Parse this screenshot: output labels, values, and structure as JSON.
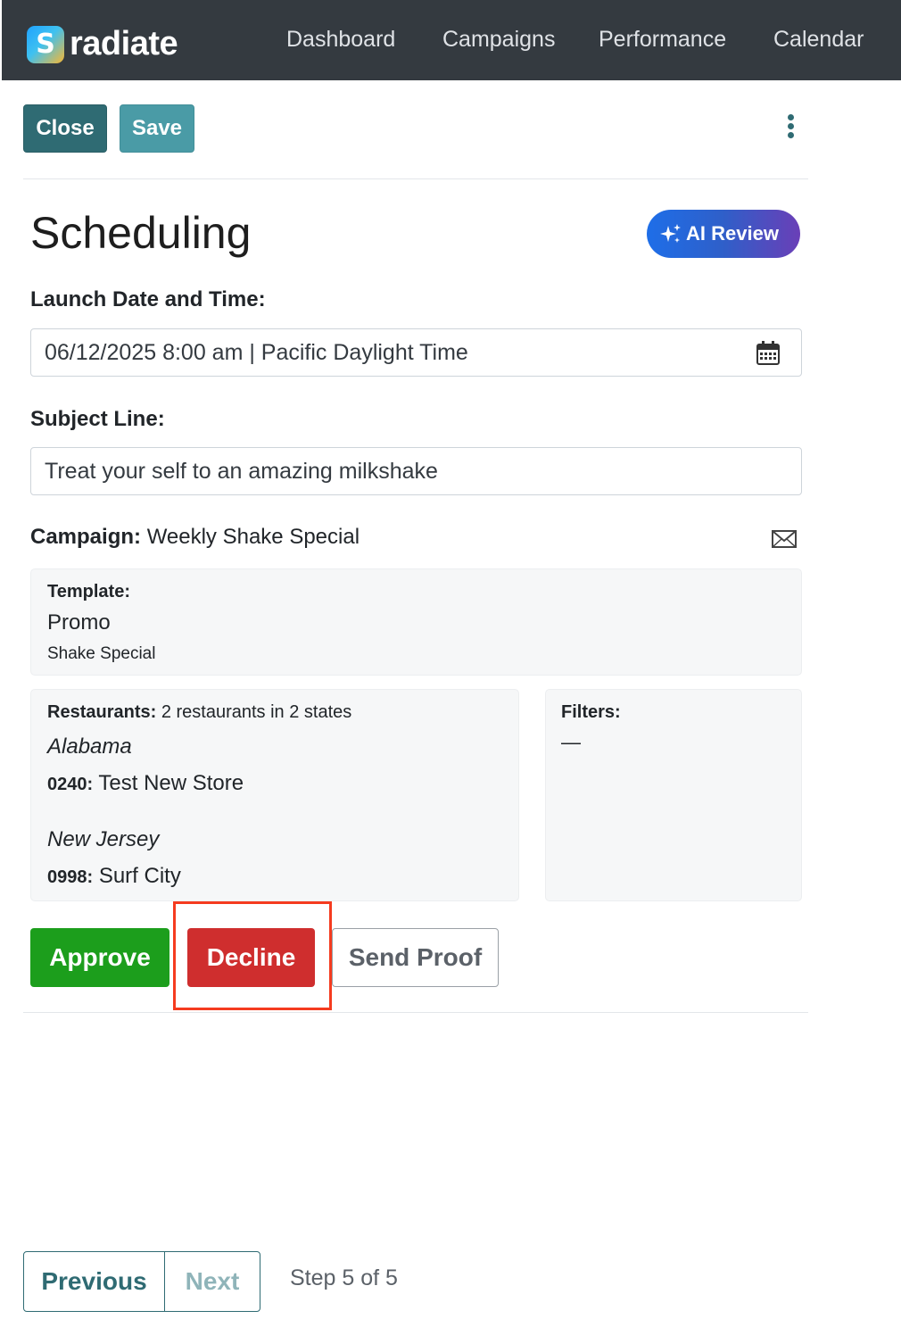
{
  "app": {
    "brand": "radiate",
    "brand_logo_letter": "S"
  },
  "nav": {
    "items": [
      {
        "label": "Dashboard"
      },
      {
        "label": "Campaigns"
      },
      {
        "label": "Performance"
      },
      {
        "label": "Calendar"
      }
    ]
  },
  "toolbar": {
    "close_label": "Close",
    "save_label": "Save",
    "more_icon": "kebab-menu-icon"
  },
  "page": {
    "title": "Scheduling",
    "ai_review_label": "AI Review"
  },
  "form": {
    "launch_label": "Launch Date and Time:",
    "launch_value": "06/12/2025 8:00 am | Pacific Daylight Time",
    "subject_label": "Subject Line:",
    "subject_value": "Treat your self to an amazing milkshake"
  },
  "campaign": {
    "label": "Campaign:",
    "name": "Weekly Shake Special"
  },
  "template": {
    "label": "Template:",
    "name": "Promo",
    "subtitle": "Shake Special"
  },
  "restaurants": {
    "label": "Restaurants:",
    "summary": "2 restaurants in 2 states",
    "groups": [
      {
        "state": "Alabama",
        "code": "0240:",
        "store": "Test New Store"
      },
      {
        "state": "New Jersey",
        "code": "0998:",
        "store": "Surf City"
      }
    ]
  },
  "filters": {
    "label": "Filters:",
    "value": "—"
  },
  "actions": {
    "approve_label": "Approve",
    "decline_label": "Decline",
    "send_proof_label": "Send Proof"
  },
  "pager": {
    "previous_label": "Previous",
    "next_label": "Next",
    "step_text": "Step 5 of 5"
  },
  "colors": {
    "nav_bg": "#343a40",
    "primary": "#2f6b73",
    "save": "#4a9ba6",
    "approve": "#1c9e1c",
    "decline": "#cf2e2e",
    "highlight": "#f53b1f"
  }
}
